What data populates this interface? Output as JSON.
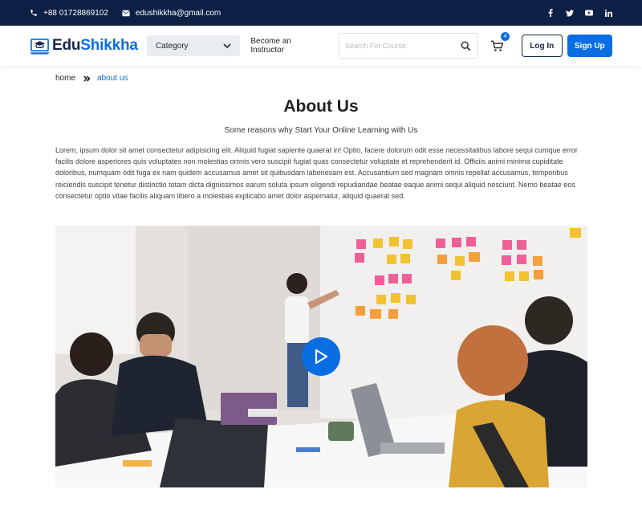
{
  "topbar": {
    "phone": "+88 01728869102",
    "email": "edushikkha@gmail.com",
    "socials": [
      "facebook-icon",
      "twitter-icon",
      "youtube-icon",
      "linkedin-icon"
    ]
  },
  "header": {
    "logo": {
      "part1": "Edu",
      "part2": "Shikkha"
    },
    "category_label": "Category",
    "become_instructor": "Become an Instructor",
    "search_placeholder": "Search For Course.",
    "cart_count": "4",
    "login": "Log In",
    "signup": "Sign Up"
  },
  "breadcrumb": {
    "home": "home",
    "current": "about us"
  },
  "main": {
    "title": "About Us",
    "subtitle": "Some reasons why Start Your Online Learning with Us",
    "paragraph": "Lorem, ipsum dolor sit amet consectetur adipisicing elit. Aliquid fugiat sapiente quaerat in! Optio, facere dolorum odit esse necessitatibus labore sequi cumque error facilis dolore asperiores quis voluptates non molestias omnis vero suscipit fugiat quas consectetur voluptate et reprehenderit id. Officiis animi minima cupiditate doloribus, numquam odit fuga ex nam quidem accusamus amet sit quibusdam laboriosam est. Accusantium sed magnam omnis repellat accusamus, temporibus reiciendis suscipit tenetur distinctio totam dicta dignissimos earum soluta ipsum eligendi repudiandae beatae eaque animi sequi aliquid nesciunt. Nemo beatae eos consectetur optio vitae facilis aliquam libero a molestias explicabo amet dolor aspernatur, aliquid quaerat sed."
  },
  "colors": {
    "accent": "#0a6ee3",
    "navy": "#0c1f44"
  }
}
